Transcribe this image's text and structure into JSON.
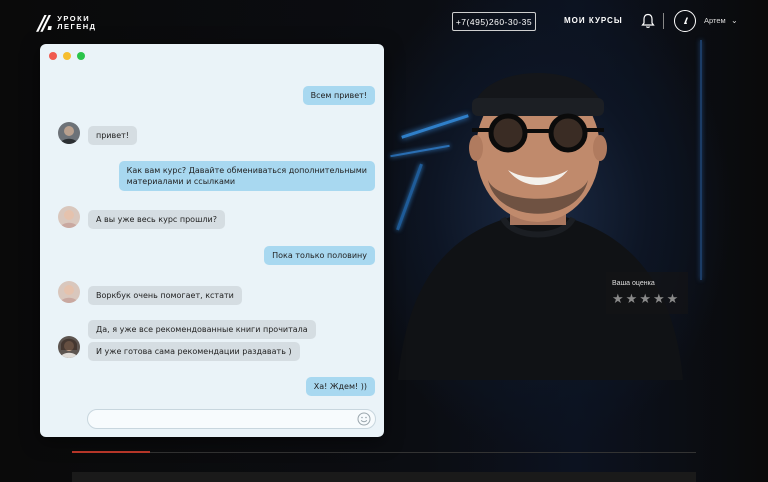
{
  "header": {
    "logo_mark": "//.",
    "logo_line1": "УРОКИ",
    "logo_line2": "ЛЕГЕНД",
    "phone": "+7(495)260-30-35",
    "nav_courses": "МОИ КУРСЫ",
    "user_name": "Артем",
    "avatar_mark": "//."
  },
  "rating": {
    "label": "Ваша оценка",
    "value": 0,
    "max": 5
  },
  "chat": {
    "messages": [
      {
        "side": "out",
        "text": "Всем привет!"
      },
      {
        "side": "in",
        "text": "привет!"
      },
      {
        "side": "out",
        "line1": "Как вам курс? Давайте обмениваться дополнительными",
        "line2": "материалами и ссылками"
      },
      {
        "side": "in",
        "text": "А вы уже весь курс прошли?"
      },
      {
        "side": "out",
        "text": "Пока только половину"
      },
      {
        "side": "in",
        "text": "Воркбук очень помогает, кстати"
      },
      {
        "side": "in",
        "text": "Да, я уже все рекомендованные книги прочитала"
      },
      {
        "side": "in",
        "text": "И уже готова сама рекомендации раздавать )"
      },
      {
        "side": "out",
        "text": "Ха! Ждем! ))"
      }
    ],
    "input_placeholder": ""
  },
  "icons": {
    "bell": "bell-icon",
    "chevron": "chevron-down-icon",
    "emoji": "emoji-icon",
    "star": "star-icon"
  },
  "colors": {
    "accent_red": "#c0392b",
    "bubble_out": "#a8d8f0",
    "bubble_in": "#d5dde2",
    "chat_bg": "#eaf3f8"
  }
}
